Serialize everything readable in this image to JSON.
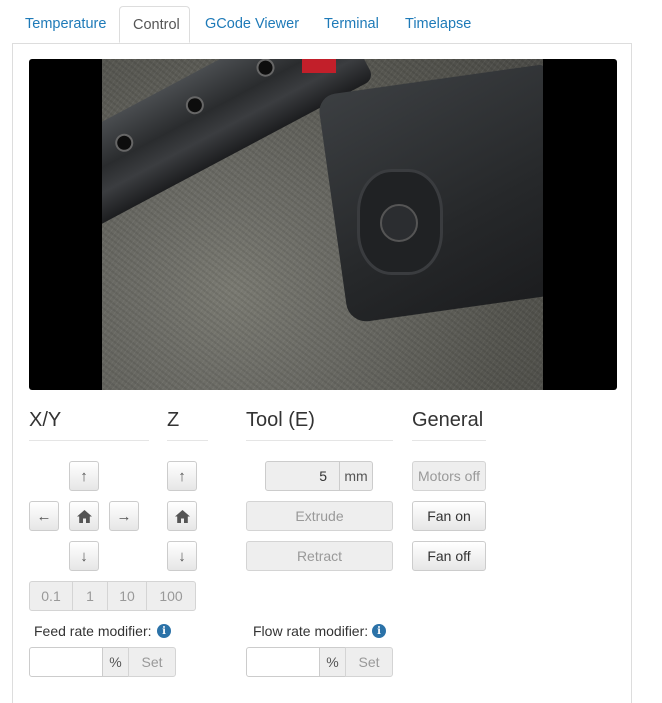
{
  "tabs": [
    {
      "label": "Temperature",
      "active": false
    },
    {
      "label": "Control",
      "active": true
    },
    {
      "label": "GCode Viewer",
      "active": false
    },
    {
      "label": "Terminal",
      "active": false
    },
    {
      "label": "Timelapse",
      "active": false
    }
  ],
  "webcam": {
    "description_icon": "webcam-stream"
  },
  "xy": {
    "title": "X/Y",
    "up_icon": "arrow-up-icon",
    "down_icon": "arrow-down-icon",
    "left_icon": "arrow-left-icon",
    "right_icon": "arrow-right-icon",
    "home_icon": "home-icon",
    "step_sizes": [
      "0.1",
      "1",
      "10",
      "100"
    ]
  },
  "z": {
    "title": "Z",
    "up_icon": "arrow-up-icon",
    "down_icon": "arrow-down-icon",
    "home_icon": "home-icon"
  },
  "tool": {
    "title": "Tool (E)",
    "amount_value": "5",
    "amount_unit": "mm",
    "extrude_label": "Extrude",
    "retract_label": "Retract"
  },
  "general": {
    "title": "General",
    "motors_off_label": "Motors off",
    "fan_on_label": "Fan on",
    "fan_off_label": "Fan off"
  },
  "feed_rate": {
    "label": "Feed rate modifier:",
    "value": "",
    "unit": "%",
    "set_label": "Set"
  },
  "flow_rate": {
    "label": "Flow rate modifier:",
    "value": "",
    "unit": "%",
    "set_label": "Set"
  },
  "icons": {
    "info": "i",
    "up": "↑",
    "down": "↓",
    "left": "←",
    "right": "→"
  },
  "colors": {
    "link": "#1e7ab8",
    "info": "#2b72a8"
  }
}
